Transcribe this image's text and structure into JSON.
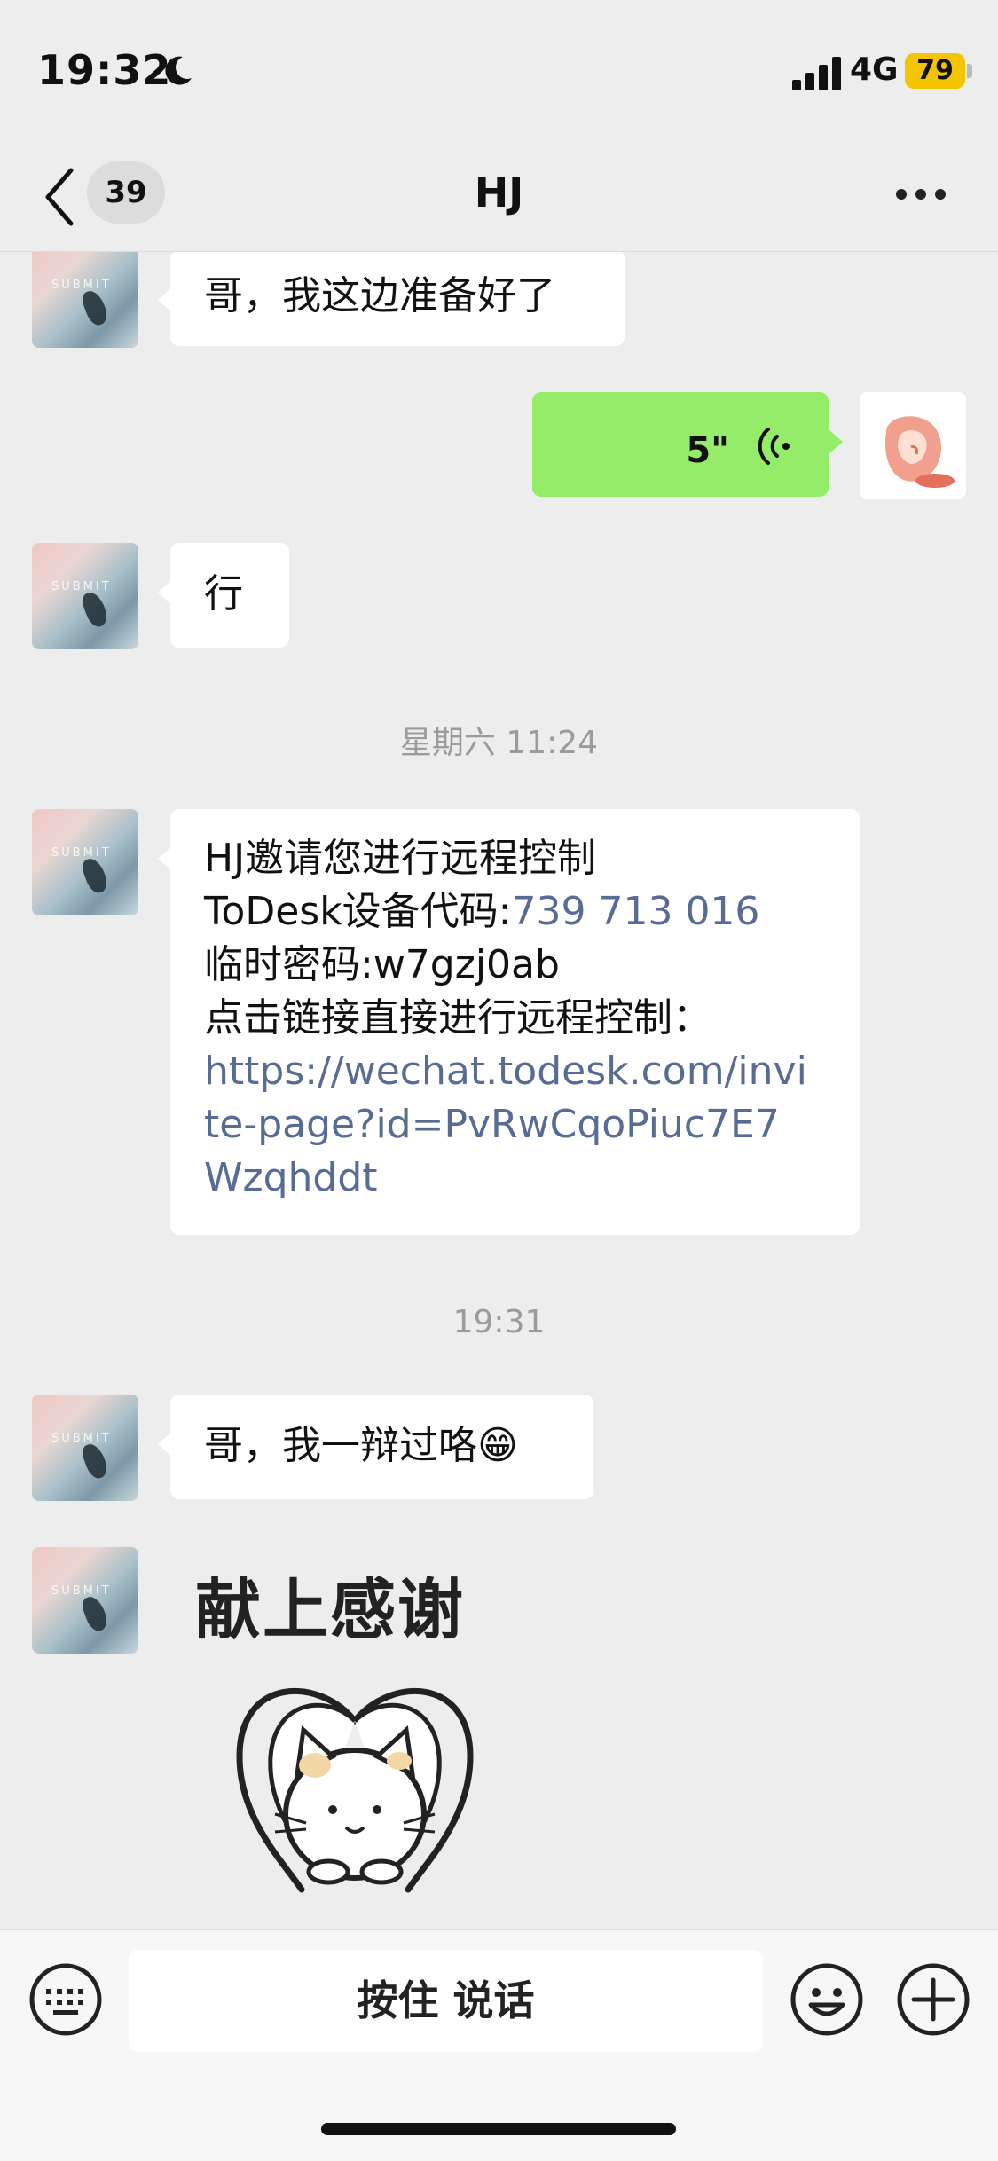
{
  "status_bar": {
    "time": "19:32",
    "network": "4G",
    "battery": "79"
  },
  "nav": {
    "unread_count": "39",
    "title": "HJ"
  },
  "messages": [
    {
      "from": "other",
      "text": "哥，我这边准备好了"
    },
    {
      "from": "self",
      "type": "voice",
      "duration": "5\""
    },
    {
      "from": "other",
      "text": "行"
    },
    {
      "type": "timestamp",
      "text": "星期六 11:24"
    },
    {
      "from": "other",
      "type": "todesk",
      "lines": [
        "HJ邀请您进行远程控制",
        "ToDesk设备代码:",
        "739 713 016",
        "临时密码:w7gzj0ab",
        "点击链接直接进行远程控制：",
        "https://wechat.todesk.com/invi",
        "te-page?id=PvRwCqoPiuc7E7",
        "Wzqhddt"
      ]
    },
    {
      "type": "timestamp",
      "text": "19:31"
    },
    {
      "from": "other",
      "text": "哥，我一辩过咯",
      "emoji": "😁"
    },
    {
      "from": "other",
      "type": "sticker",
      "text": "献上感谢"
    }
  ],
  "avatar_text": "SUBMIT",
  "input": {
    "hold_to_talk": "按住 说话"
  },
  "colors": {
    "bubble_green": "#95ec69",
    "link": "#576b95",
    "background": "#ededed"
  }
}
